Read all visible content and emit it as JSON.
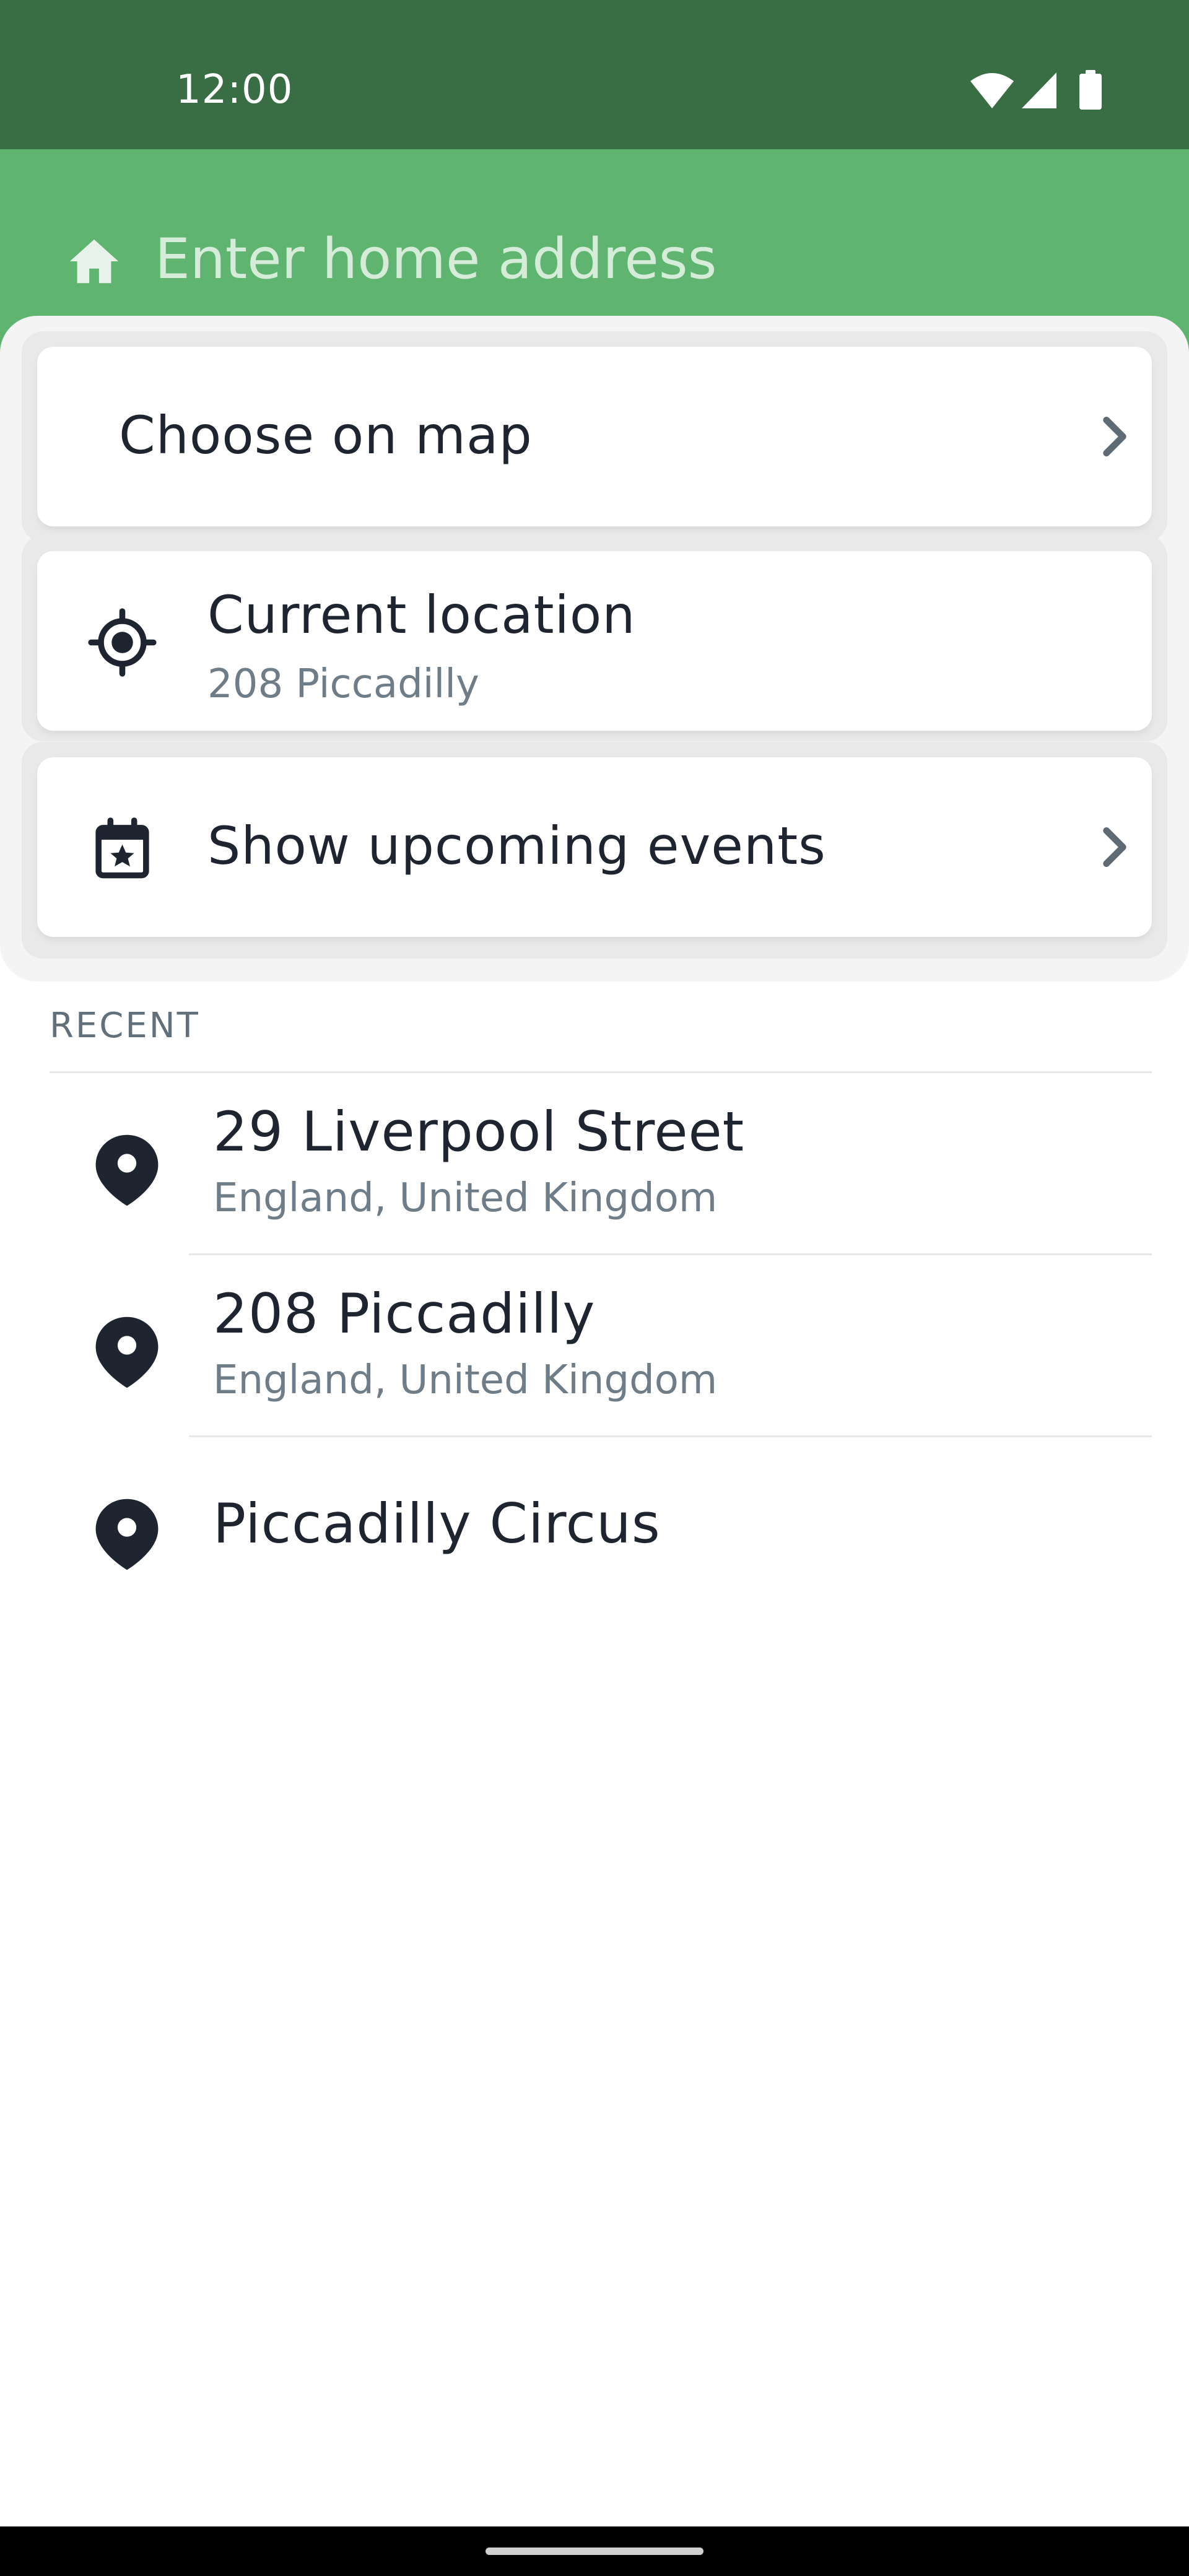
{
  "status_bar": {
    "time": "12:00",
    "icons": [
      "wifi-icon",
      "cellular-signal-icon",
      "battery-icon"
    ]
  },
  "search": {
    "placeholder": "Enter home address",
    "icon": "home-icon"
  },
  "options": [
    {
      "label": "Choose on map",
      "icon": "chevron-right-icon"
    },
    {
      "label": "Current location",
      "sublabel": "208 Piccadilly",
      "icon": "location-target-icon"
    },
    {
      "label": "Show upcoming events",
      "icon": "calendar-star-icon"
    }
  ],
  "recent": {
    "heading": "RECENT",
    "items": [
      {
        "title": "29 Liverpool Street",
        "subtitle": "England, United Kingdom"
      },
      {
        "title": "208 Piccadilly",
        "subtitle": "England, United Kingdom"
      },
      {
        "title": "Piccadilly Circus"
      }
    ]
  },
  "colors": {
    "status_bar": "#396d43",
    "header": "#5fb46f",
    "text_primary": "#1f2530",
    "text_secondary": "#6e7d87"
  }
}
